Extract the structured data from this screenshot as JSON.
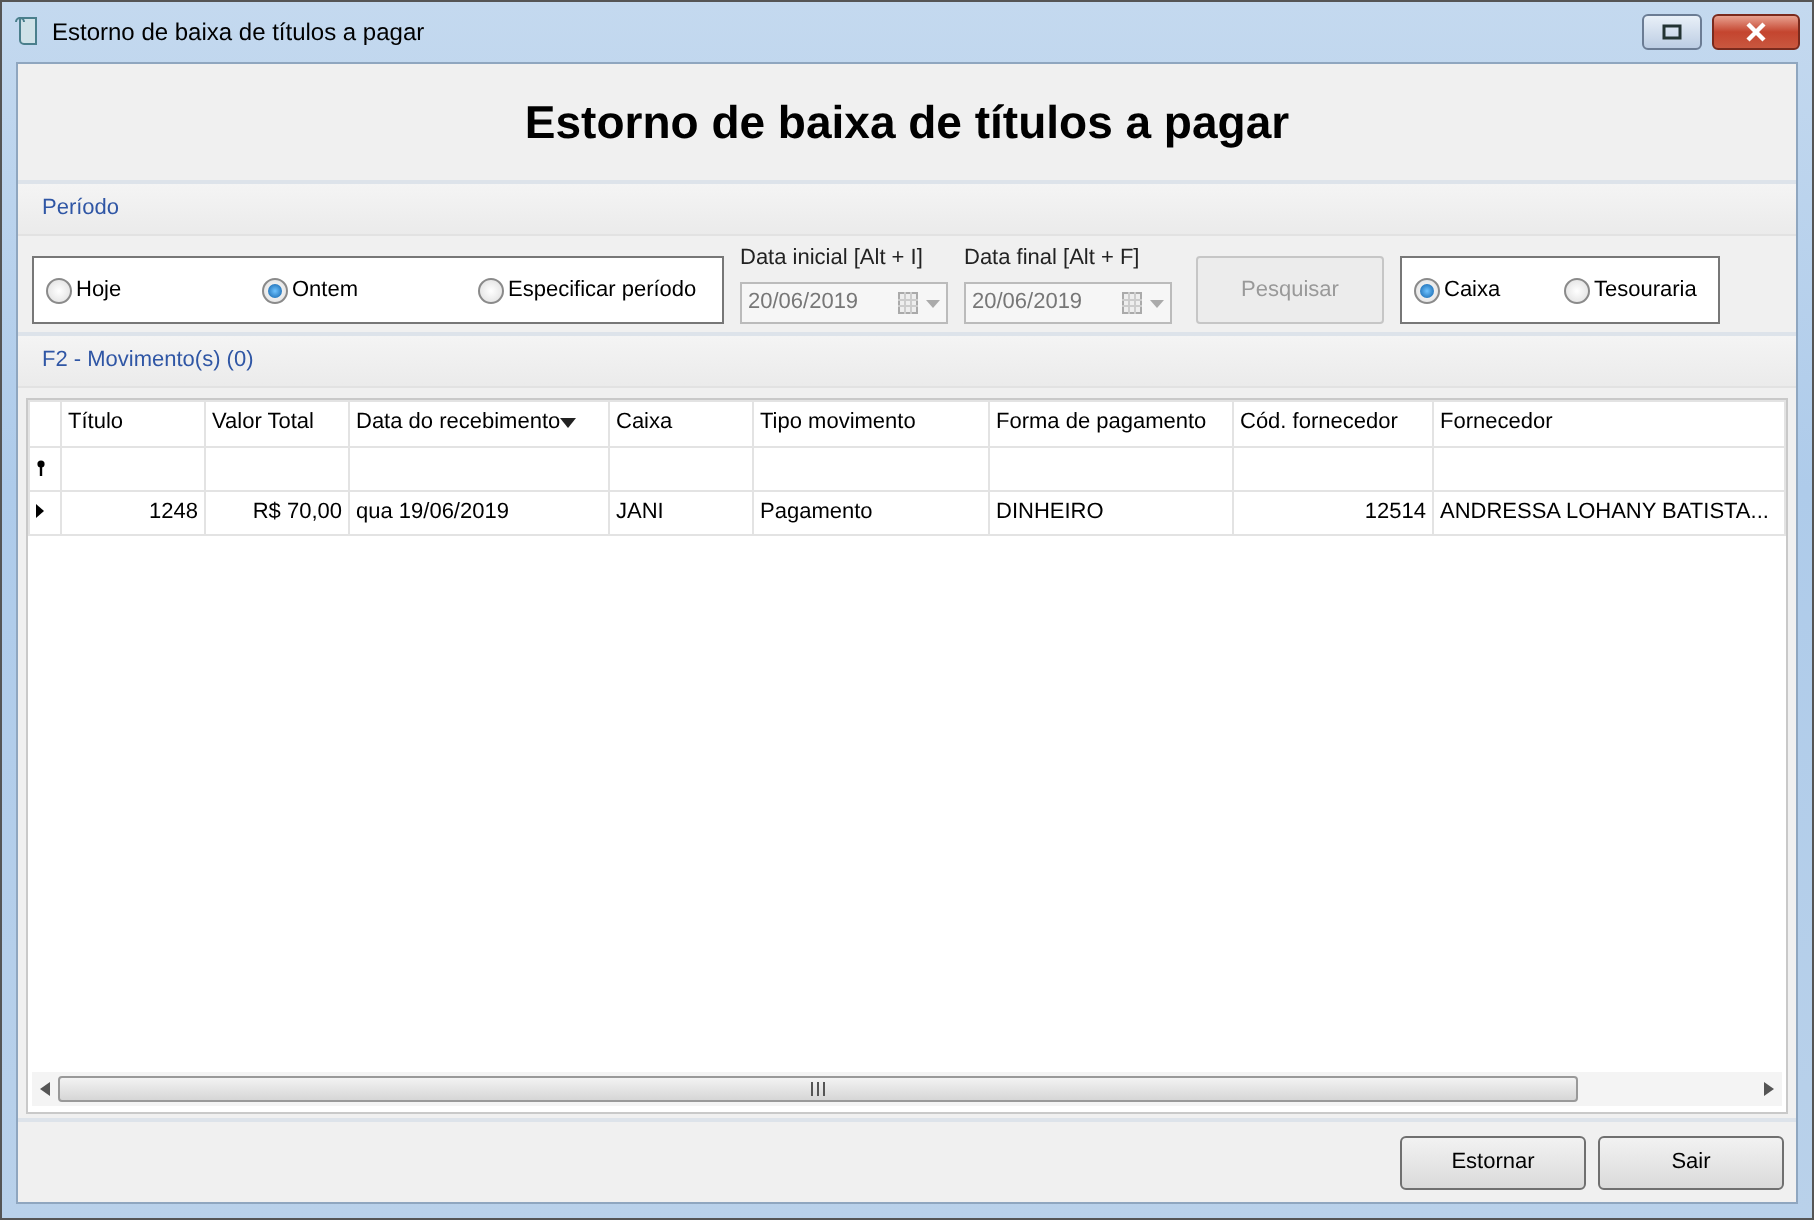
{
  "window": {
    "title": "Estorno de baixa de títulos a pagar"
  },
  "heading": "Estorno de baixa de títulos a pagar",
  "period": {
    "label": "Período",
    "options": [
      {
        "label": "Hoje",
        "selected": false
      },
      {
        "label": "Ontem",
        "selected": true
      },
      {
        "label": "Especificar período",
        "selected": false
      }
    ],
    "date_fields": [
      {
        "label": "Data inicial [Alt + I]",
        "value": "20/06/2019",
        "disabled": true
      },
      {
        "label": "Data final [Alt + F]",
        "value": "20/06/2019",
        "disabled": true
      }
    ],
    "search_button": {
      "label": "Pesquisar",
      "disabled": true
    },
    "source_options": [
      {
        "label": "Caixa",
        "selected": true
      },
      {
        "label": "Tesouraria",
        "selected": false
      }
    ]
  },
  "movements": {
    "label": "F2 - Movimento(s) (0)",
    "columns": [
      {
        "label": "Título",
        "kind": "number",
        "sorted": false
      },
      {
        "label": "Valor Total",
        "kind": "number",
        "sorted": false
      },
      {
        "label": "Data do recebimento",
        "kind": "text",
        "sorted": true
      },
      {
        "label": "Caixa",
        "kind": "text",
        "sorted": false
      },
      {
        "label": "Tipo movimento",
        "kind": "text",
        "sorted": false
      },
      {
        "label": "Forma de pagamento",
        "kind": "text",
        "sorted": false
      },
      {
        "label": "Cód. fornecedor",
        "kind": "number",
        "sorted": false
      },
      {
        "label": "Fornecedor",
        "kind": "text",
        "sorted": false
      }
    ],
    "rows": [
      {
        "current": true,
        "cells": [
          "1248",
          "R$ 70,00",
          "qua 19/06/2019",
          "JANI",
          "Pagamento",
          "DINHEIRO",
          "12514",
          "ANDRESSA LOHANY BATISTA..."
        ]
      }
    ]
  },
  "buttons": [
    "Estornar",
    "Sair"
  ]
}
